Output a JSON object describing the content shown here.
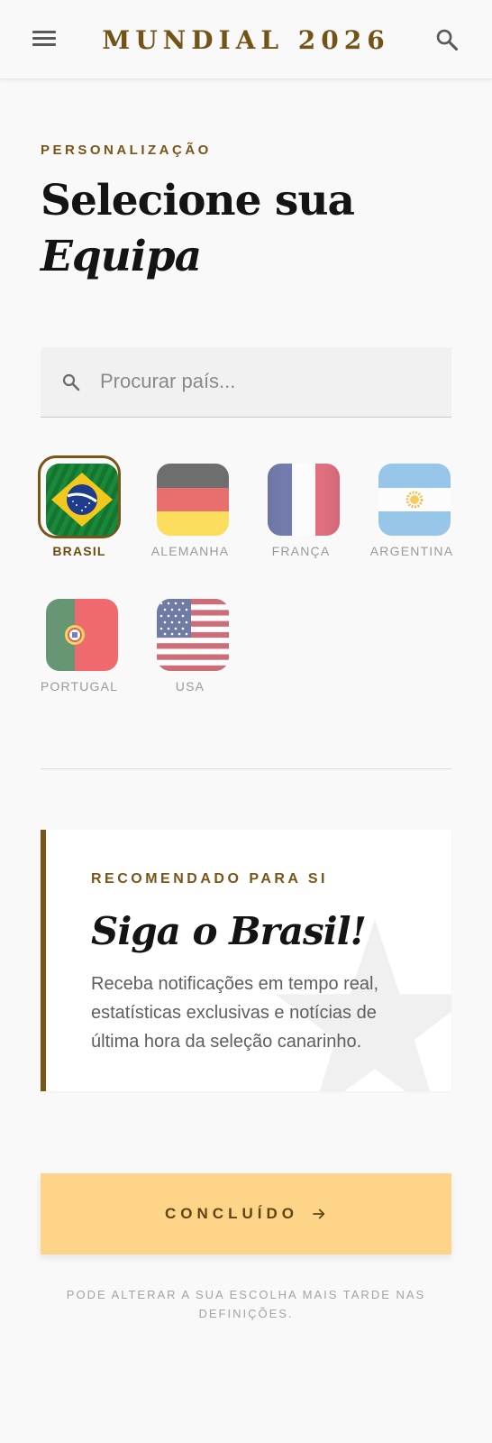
{
  "header": {
    "title": "MUNDIAL 2026",
    "menu_icon": "hamburger-menu-icon",
    "search_icon": "search-icon"
  },
  "hero": {
    "eyebrow": "PERSONALIZAÇÃO",
    "title_line1": "Selecione sua",
    "title_line2": "Equipa"
  },
  "search": {
    "placeholder": "Procurar país...",
    "value": ""
  },
  "teams": [
    {
      "name": "BRASIL",
      "selected": true
    },
    {
      "name": "ALEMANHA",
      "selected": false
    },
    {
      "name": "FRANÇA",
      "selected": false
    },
    {
      "name": "ARGENTINA",
      "selected": false
    },
    {
      "name": "PORTUGAL",
      "selected": false
    },
    {
      "name": "USA",
      "selected": false
    }
  ],
  "recommendation": {
    "kicker": "RECOMENDADO PARA SI",
    "title": "Siga o Brasil!",
    "description": "Receba notificações em tempo real, estatísticas exclusivas e notícias de última hora da seleção canarinho."
  },
  "done_button": {
    "label": "CONCLUÍDO",
    "icon": "arrow-right-icon"
  },
  "footnote": "PODE ALTERAR A SUA ESCOLHA MAIS TARDE NAS DEFINIÇÕES.",
  "colors": {
    "accent": "#7a5518",
    "button_bg": "#fdd488",
    "background": "#f9f9f9"
  }
}
